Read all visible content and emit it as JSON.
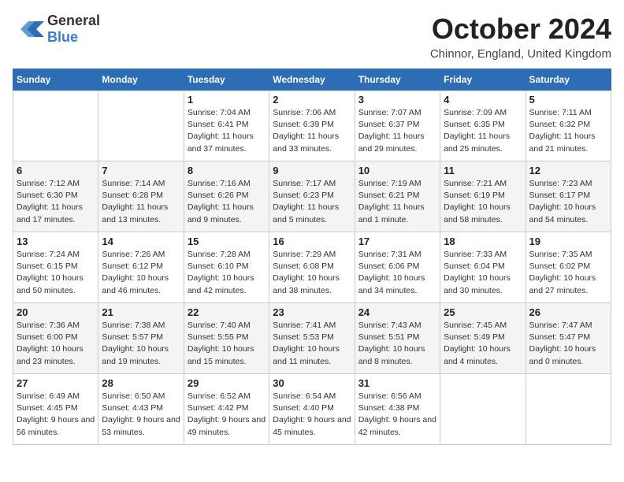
{
  "header": {
    "logo_general": "General",
    "logo_blue": "Blue",
    "month_title": "October 2024",
    "location": "Chinnor, England, United Kingdom"
  },
  "days_of_week": [
    "Sunday",
    "Monday",
    "Tuesday",
    "Wednesday",
    "Thursday",
    "Friday",
    "Saturday"
  ],
  "weeks": [
    [
      {
        "day": "",
        "info": ""
      },
      {
        "day": "",
        "info": ""
      },
      {
        "day": "1",
        "info": "Sunrise: 7:04 AM\nSunset: 6:41 PM\nDaylight: 11 hours and 37 minutes."
      },
      {
        "day": "2",
        "info": "Sunrise: 7:06 AM\nSunset: 6:39 PM\nDaylight: 11 hours and 33 minutes."
      },
      {
        "day": "3",
        "info": "Sunrise: 7:07 AM\nSunset: 6:37 PM\nDaylight: 11 hours and 29 minutes."
      },
      {
        "day": "4",
        "info": "Sunrise: 7:09 AM\nSunset: 6:35 PM\nDaylight: 11 hours and 25 minutes."
      },
      {
        "day": "5",
        "info": "Sunrise: 7:11 AM\nSunset: 6:32 PM\nDaylight: 11 hours and 21 minutes."
      }
    ],
    [
      {
        "day": "6",
        "info": "Sunrise: 7:12 AM\nSunset: 6:30 PM\nDaylight: 11 hours and 17 minutes."
      },
      {
        "day": "7",
        "info": "Sunrise: 7:14 AM\nSunset: 6:28 PM\nDaylight: 11 hours and 13 minutes."
      },
      {
        "day": "8",
        "info": "Sunrise: 7:16 AM\nSunset: 6:26 PM\nDaylight: 11 hours and 9 minutes."
      },
      {
        "day": "9",
        "info": "Sunrise: 7:17 AM\nSunset: 6:23 PM\nDaylight: 11 hours and 5 minutes."
      },
      {
        "day": "10",
        "info": "Sunrise: 7:19 AM\nSunset: 6:21 PM\nDaylight: 11 hours and 1 minute."
      },
      {
        "day": "11",
        "info": "Sunrise: 7:21 AM\nSunset: 6:19 PM\nDaylight: 10 hours and 58 minutes."
      },
      {
        "day": "12",
        "info": "Sunrise: 7:23 AM\nSunset: 6:17 PM\nDaylight: 10 hours and 54 minutes."
      }
    ],
    [
      {
        "day": "13",
        "info": "Sunrise: 7:24 AM\nSunset: 6:15 PM\nDaylight: 10 hours and 50 minutes."
      },
      {
        "day": "14",
        "info": "Sunrise: 7:26 AM\nSunset: 6:12 PM\nDaylight: 10 hours and 46 minutes."
      },
      {
        "day": "15",
        "info": "Sunrise: 7:28 AM\nSunset: 6:10 PM\nDaylight: 10 hours and 42 minutes."
      },
      {
        "day": "16",
        "info": "Sunrise: 7:29 AM\nSunset: 6:08 PM\nDaylight: 10 hours and 38 minutes."
      },
      {
        "day": "17",
        "info": "Sunrise: 7:31 AM\nSunset: 6:06 PM\nDaylight: 10 hours and 34 minutes."
      },
      {
        "day": "18",
        "info": "Sunrise: 7:33 AM\nSunset: 6:04 PM\nDaylight: 10 hours and 30 minutes."
      },
      {
        "day": "19",
        "info": "Sunrise: 7:35 AM\nSunset: 6:02 PM\nDaylight: 10 hours and 27 minutes."
      }
    ],
    [
      {
        "day": "20",
        "info": "Sunrise: 7:36 AM\nSunset: 6:00 PM\nDaylight: 10 hours and 23 minutes."
      },
      {
        "day": "21",
        "info": "Sunrise: 7:38 AM\nSunset: 5:57 PM\nDaylight: 10 hours and 19 minutes."
      },
      {
        "day": "22",
        "info": "Sunrise: 7:40 AM\nSunset: 5:55 PM\nDaylight: 10 hours and 15 minutes."
      },
      {
        "day": "23",
        "info": "Sunrise: 7:41 AM\nSunset: 5:53 PM\nDaylight: 10 hours and 11 minutes."
      },
      {
        "day": "24",
        "info": "Sunrise: 7:43 AM\nSunset: 5:51 PM\nDaylight: 10 hours and 8 minutes."
      },
      {
        "day": "25",
        "info": "Sunrise: 7:45 AM\nSunset: 5:49 PM\nDaylight: 10 hours and 4 minutes."
      },
      {
        "day": "26",
        "info": "Sunrise: 7:47 AM\nSunset: 5:47 PM\nDaylight: 10 hours and 0 minutes."
      }
    ],
    [
      {
        "day": "27",
        "info": "Sunrise: 6:49 AM\nSunset: 4:45 PM\nDaylight: 9 hours and 56 minutes."
      },
      {
        "day": "28",
        "info": "Sunrise: 6:50 AM\nSunset: 4:43 PM\nDaylight: 9 hours and 53 minutes."
      },
      {
        "day": "29",
        "info": "Sunrise: 6:52 AM\nSunset: 4:42 PM\nDaylight: 9 hours and 49 minutes."
      },
      {
        "day": "30",
        "info": "Sunrise: 6:54 AM\nSunset: 4:40 PM\nDaylight: 9 hours and 45 minutes."
      },
      {
        "day": "31",
        "info": "Sunrise: 6:56 AM\nSunset: 4:38 PM\nDaylight: 9 hours and 42 minutes."
      },
      {
        "day": "",
        "info": ""
      },
      {
        "day": "",
        "info": ""
      }
    ]
  ]
}
